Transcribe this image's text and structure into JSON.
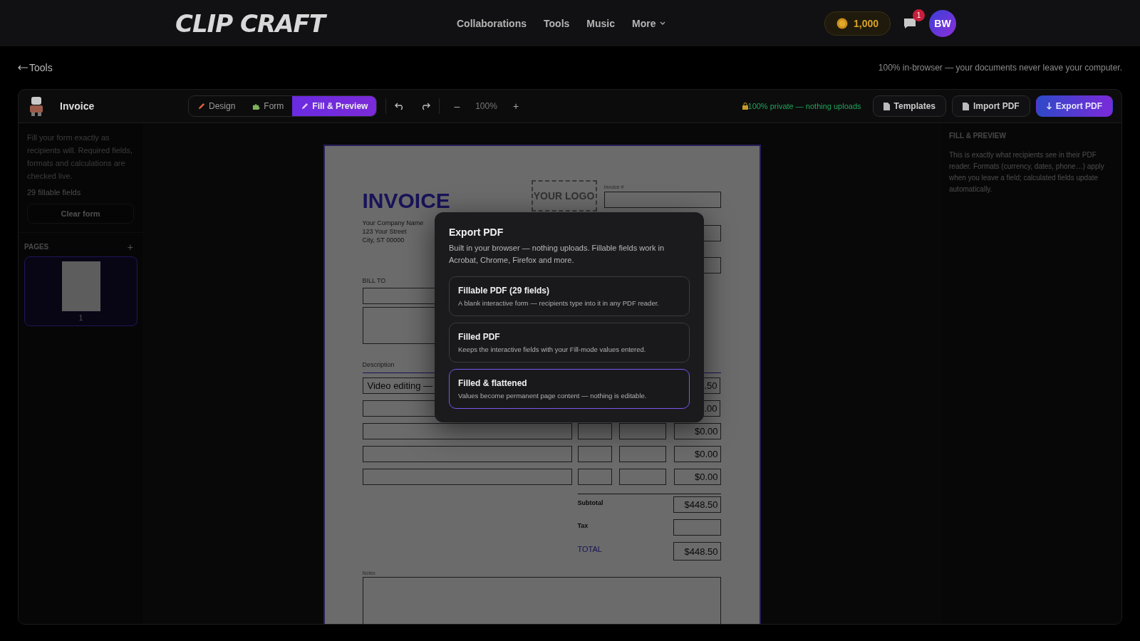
{
  "header": {
    "logo": "CLIP CRAFT",
    "nav": [
      "Collaborations",
      "Tools",
      "Music"
    ],
    "more": "More",
    "coins": "1,000",
    "notification_count": "1",
    "avatar": "BW"
  },
  "back_link": "Tools",
  "privacy_note": "100% in-browser — your documents never leave your computer.",
  "toolbar": {
    "title": "Invoice",
    "modes": [
      {
        "label": "Design",
        "kind": "design",
        "selected": false
      },
      {
        "label": "Form",
        "kind": "form",
        "selected": false
      },
      {
        "label": "Fill & Preview",
        "kind": "fill",
        "selected": true
      }
    ],
    "zoom_out": "–",
    "zoom": "100%",
    "zoom_in": "+",
    "private_note": "100% private — nothing uploads",
    "buttons": [
      {
        "label": "Templates",
        "kind": "secondary"
      },
      {
        "label": "Import PDF",
        "kind": "secondary"
      },
      {
        "label": "Export PDF",
        "kind": "primary"
      }
    ]
  },
  "sidebar": {
    "help": "Fill your form exactly as recipients will. Required fields, formats and calculations are checked live.",
    "field_count": "29 fillable fields",
    "clear_button": "Clear form",
    "pages_title": "PAGES",
    "add_page": "+",
    "pages": [
      {
        "number": "1",
        "selected": true
      }
    ]
  },
  "invoice": {
    "title": "INVOICE",
    "company": [
      "Your Company Name",
      "123 Your Street",
      "City, ST 00000"
    ],
    "logo_text": "YOUR LOGO",
    "invoice_number_label": "Invoice #",
    "bill_to": "BILL TO",
    "description_header": "Description",
    "items": [
      {
        "description": "Video editing —",
        "amount": ".50"
      },
      {
        "amount": ".00"
      },
      {
        "amount": "$0.00"
      },
      {
        "amount": "$0.00"
      },
      {
        "amount": "$0.00"
      }
    ],
    "subtotal_label": "Subtotal",
    "subtotal": "$448.50",
    "tax_label": "Tax",
    "total_label": "TOTAL",
    "total": "$448.50",
    "notes_label": "Notes"
  },
  "right_panel": {
    "title": "FILL & PREVIEW",
    "text": "This is exactly what recipients see in their PDF reader. Formats (currency, dates, phone…) apply when you leave a field; calculated fields update automatically."
  },
  "export_dialog": {
    "title": "Export PDF",
    "text": "Built in your browser — nothing uploads. Fillable fields work in Acrobat, Chrome, Firefox and more.",
    "options": [
      {
        "title": "Fillable PDF (29 fields)",
        "text": "A blank interactive form — recipients type into it in any PDF reader.",
        "selected": false
      },
      {
        "title": "Filled PDF",
        "text": "Keeps the interactive fields with your Fill-mode values entered.",
        "selected": false
      },
      {
        "title": "Filled & flattened",
        "text": "Values become permanent page content — nothing is editable.",
        "selected": true
      }
    ]
  }
}
